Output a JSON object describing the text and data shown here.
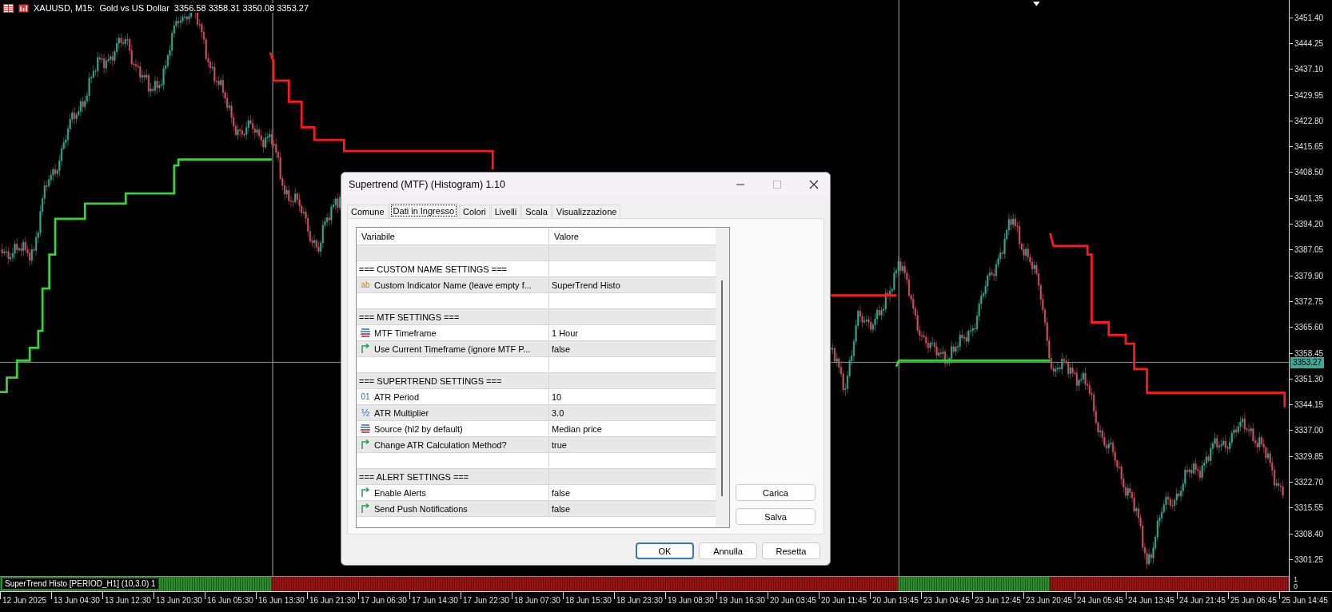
{
  "chart_header": {
    "symbol": "XAUUSD, M15:",
    "description": "Gold vs US Dollar",
    "ohlc": "3356.58 3358.31 3350.08 3353.27"
  },
  "price_axis": {
    "labels": [
      "3451.40",
      "3444.25",
      "3437.10",
      "3429.95",
      "3422.80",
      "3415.65",
      "3408.50",
      "3401.35",
      "3394.20",
      "3387.05",
      "3379.90",
      "3372.75",
      "3365.60",
      "3358.45",
      "3351.30",
      "3344.15",
      "3337.00",
      "3329.85",
      "3322.70",
      "3315.55",
      "3308.40",
      "3301.25"
    ],
    "current_price": "3353.27"
  },
  "indicator_panel": {
    "label": "SuperTrend Histo [PERIOD_H1] (10,3.0) 1",
    "scale": [
      "1",
      "0"
    ],
    "segments": [
      {
        "color": "#2e8b2e"
      },
      {
        "color": "#9b1414"
      },
      {
        "color": "#2e8b2e"
      },
      {
        "color": "#9b1414"
      }
    ]
  },
  "time_axis": {
    "labels": [
      "12 Jun 2025",
      "13 Jun 04:30",
      "13 Jun 12:30",
      "13 Jun 20:30",
      "16 Jun 05:30",
      "16 Jun 13:30",
      "16 Jun 21:30",
      "17 Jun 06:30",
      "17 Jun 14:30",
      "17 Jun 22:30",
      "18 Jun 07:30",
      "18 Jun 15:30",
      "18 Jun 23:30",
      "19 Jun 08:30",
      "19 Jun 16:30",
      "20 Jun 03:45",
      "20 Jun 11:45",
      "20 Jun 19:45",
      "23 Jun 04:45",
      "23 Jun 12:45",
      "23 Jun 20:45",
      "24 Jun 05:45",
      "24 Jun 13:45",
      "24 Jun 21:45",
      "25 Jun 06:45",
      "25 Jun 14:45"
    ]
  },
  "dialog": {
    "title": "Supertrend (MTF) (Histogram) 1.10",
    "tabs": [
      {
        "label": "Comune",
        "selected": false
      },
      {
        "label": "Dati in Ingresso",
        "selected": true
      },
      {
        "label": "Colori",
        "selected": false
      },
      {
        "label": "Livelli",
        "selected": false
      },
      {
        "label": "Scala",
        "selected": false
      },
      {
        "label": "Visualizzazione",
        "selected": false
      }
    ],
    "table": {
      "columns": [
        "Variabile",
        "Valore"
      ],
      "rows": [
        {
          "kind": "blank"
        },
        {
          "kind": "section",
          "label": "=== CUSTOM NAME SETTINGS ==="
        },
        {
          "kind": "string",
          "glyph": "ab",
          "label": "Custom Indicator Name (leave empty f...",
          "value": "SuperTrend Histo"
        },
        {
          "kind": "blank"
        },
        {
          "kind": "section",
          "label": "=== MTF SETTINGS ==="
        },
        {
          "kind": "enum",
          "label": "MTF Timeframe",
          "value": "1 Hour"
        },
        {
          "kind": "bool",
          "label": "Use Current Timeframe (ignore MTF P...",
          "value": "false"
        },
        {
          "kind": "blank"
        },
        {
          "kind": "section",
          "label": "=== SUPERTREND SETTINGS ==="
        },
        {
          "kind": "int",
          "glyph": "01",
          "label": "ATR Period",
          "value": "10"
        },
        {
          "kind": "double",
          "glyph": "½",
          "label": "ATR Multiplier",
          "value": "3.0"
        },
        {
          "kind": "enum",
          "label": "Source (hl2 by default)",
          "value": "Median price"
        },
        {
          "kind": "bool",
          "label": "Change ATR Calculation Method?",
          "value": "true"
        },
        {
          "kind": "blank"
        },
        {
          "kind": "section",
          "label": "=== ALERT SETTINGS ==="
        },
        {
          "kind": "bool",
          "label": "Enable Alerts",
          "value": "false"
        },
        {
          "kind": "bool",
          "label": "Send Push Notifications",
          "value": "false"
        }
      ]
    },
    "side_buttons": [
      "Carica",
      "Salva"
    ],
    "buttons": [
      {
        "label": "OK",
        "default": true
      },
      {
        "label": "Annulla",
        "default": false
      },
      {
        "label": "Resetta",
        "default": false
      }
    ]
  }
}
